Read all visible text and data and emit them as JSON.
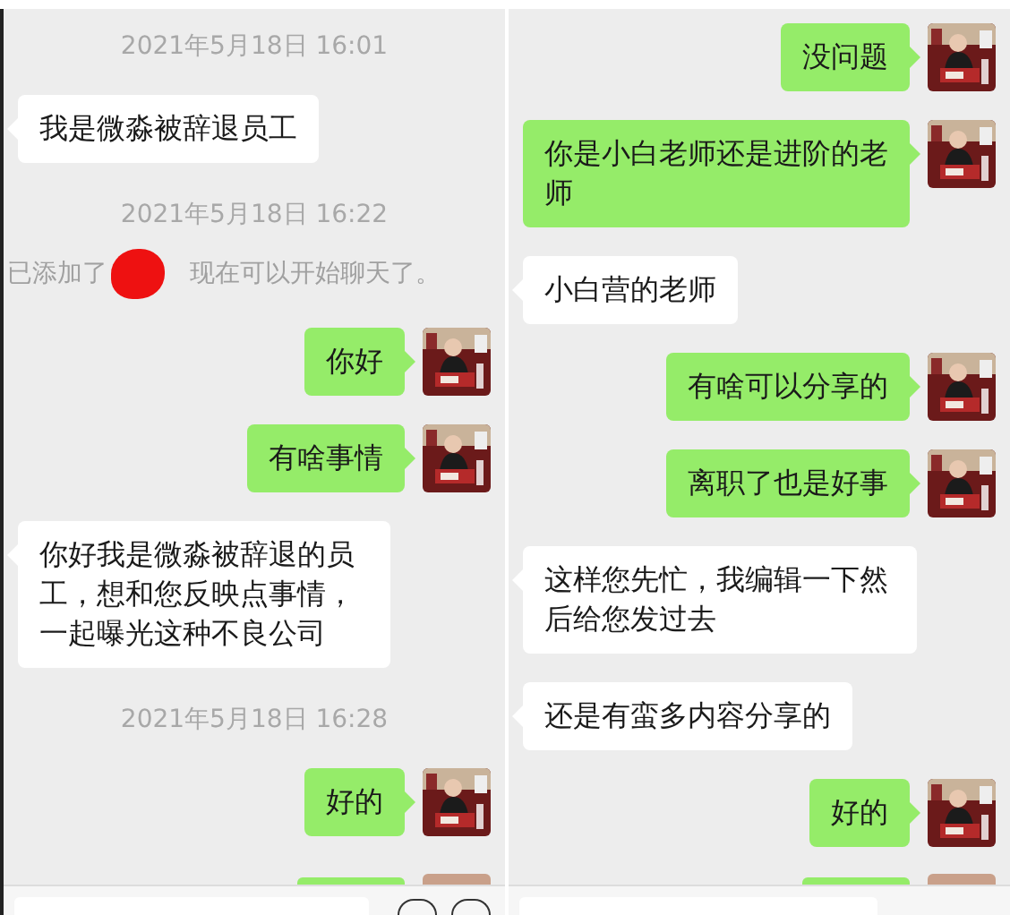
{
  "panes": [
    {
      "messages": [
        {
          "kind": "time",
          "text": "2021年5月18日 16:01"
        },
        {
          "kind": "in",
          "text": "我是微淼被辞退员工"
        },
        {
          "kind": "time",
          "text": "2021年5月18日 16:22"
        },
        {
          "kind": "system",
          "text": "已添加了",
          "text_after": "现在可以开始聊天了。"
        },
        {
          "kind": "out",
          "text": "你好"
        },
        {
          "kind": "out",
          "text": "有啥事情"
        },
        {
          "kind": "in",
          "text": "你好我是微淼被辞退的员工，想和您反映点事情，一起曝光这种不良公司"
        },
        {
          "kind": "time",
          "text": "2021年5月18日 16:28"
        },
        {
          "kind": "out",
          "text": "好的"
        }
      ]
    },
    {
      "messages": [
        {
          "kind": "out",
          "text": "没问题"
        },
        {
          "kind": "out",
          "text": "你是小白老师还是进阶的老师"
        },
        {
          "kind": "in",
          "text": "小白营的老师"
        },
        {
          "kind": "out",
          "text": "有啥可以分享的"
        },
        {
          "kind": "out",
          "text": "离职了也是好事"
        },
        {
          "kind": "in",
          "text": "这样您先忙，我编辑一下然后给您发过去"
        },
        {
          "kind": "in",
          "text": "还是有蛮多内容分享的"
        },
        {
          "kind": "out",
          "text": "好的"
        }
      ]
    }
  ]
}
